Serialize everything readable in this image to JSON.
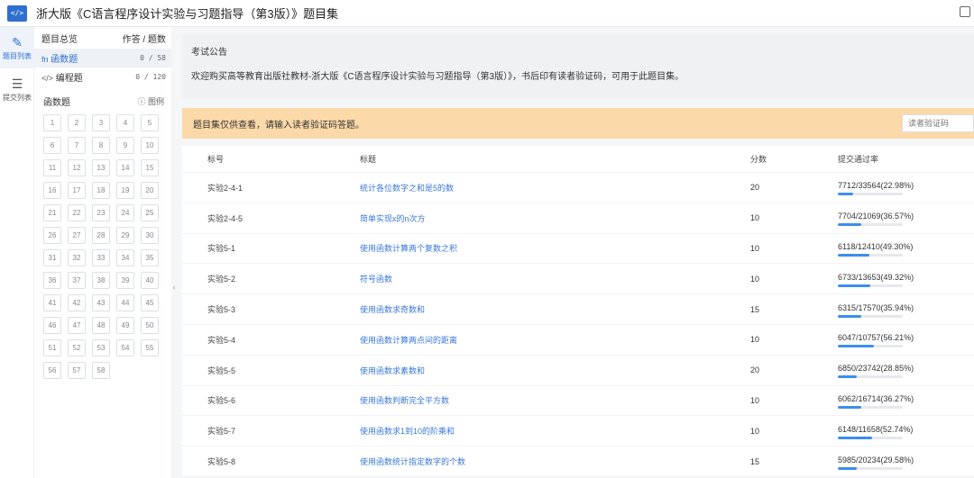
{
  "header": {
    "logo_text": "</>",
    "title": "浙大版《C语言程序设计实验与习题指导（第3版）》题目集"
  },
  "rail": [
    {
      "label": "题目列表",
      "icon": "edit-list-icon",
      "glyph": "✎"
    },
    {
      "label": "提交列表",
      "icon": "list-icon",
      "glyph": "☰"
    }
  ],
  "panel": {
    "overview": "题目总览",
    "counts_header": "作答 / 题数",
    "types": [
      {
        "glyph": "fn",
        "label": "函数题",
        "count": "0 / 58",
        "icon": "function-icon"
      },
      {
        "glyph": "</>",
        "label": "编程题",
        "count": "0 / 120",
        "icon": "code-icon"
      }
    ],
    "section_title": "函数题",
    "legend_label": "ⓘ 图例",
    "grid": [
      "1",
      "2",
      "3",
      "4",
      "5",
      "6",
      "7",
      "8",
      "9",
      "10",
      "11",
      "12",
      "13",
      "14",
      "15",
      "16",
      "17",
      "18",
      "19",
      "20",
      "21",
      "22",
      "23",
      "24",
      "25",
      "26",
      "27",
      "28",
      "29",
      "30",
      "31",
      "32",
      "33",
      "34",
      "35",
      "36",
      "37",
      "38",
      "39",
      "40",
      "41",
      "42",
      "43",
      "44",
      "45",
      "46",
      "47",
      "48",
      "49",
      "50",
      "51",
      "52",
      "53",
      "54",
      "55",
      "56",
      "57",
      "58"
    ]
  },
  "notice": {
    "title": "考试公告",
    "text": "欢迎购买高等教育出版社教材-浙大版《C语言程序设计实验与习题指导（第3版）》，书后印有读者验证码，可用于此题目集。"
  },
  "warning": {
    "text": "题目集仅供查看，请输入读者验证码答题。",
    "input_placeholder": "读者验证码"
  },
  "table": {
    "headers": {
      "id": "标号",
      "title": "标题",
      "score": "分数",
      "rate": "提交通过率"
    },
    "rows": [
      {
        "id": "实验2-4-1",
        "title": "统计各位数字之和是5的数",
        "score": "20",
        "rate": "7712/33564(22.98%)",
        "pct": 22.98
      },
      {
        "id": "实验2-4-5",
        "title": "简单实现x的n次方",
        "score": "10",
        "rate": "7704/21069(36.57%)",
        "pct": 36.57
      },
      {
        "id": "实验5-1",
        "title": "使用函数计算两个复数之积",
        "score": "10",
        "rate": "6118/12410(49.30%)",
        "pct": 49.3
      },
      {
        "id": "实验5-2",
        "title": "符号函数",
        "score": "10",
        "rate": "6733/13653(49.32%)",
        "pct": 49.32
      },
      {
        "id": "实验5-3",
        "title": "使用函数求奇数和",
        "score": "15",
        "rate": "6315/17570(35.94%)",
        "pct": 35.94
      },
      {
        "id": "实验5-4",
        "title": "使用函数计算两点间的距离",
        "score": "10",
        "rate": "6047/10757(56.21%)",
        "pct": 56.21
      },
      {
        "id": "实验5-5",
        "title": "使用函数求素数和",
        "score": "20",
        "rate": "6850/23742(28.85%)",
        "pct": 28.85
      },
      {
        "id": "实验5-6",
        "title": "使用函数判断完全平方数",
        "score": "10",
        "rate": "6062/16714(36.27%)",
        "pct": 36.27
      },
      {
        "id": "实验5-7",
        "title": "使用函数求1到10的阶乘和",
        "score": "10",
        "rate": "6148/11658(52.74%)",
        "pct": 52.74
      },
      {
        "id": "实验5-8",
        "title": "使用函数统计指定数字的个数",
        "score": "15",
        "rate": "5985/20234(29.58%)",
        "pct": 29.58
      }
    ]
  }
}
